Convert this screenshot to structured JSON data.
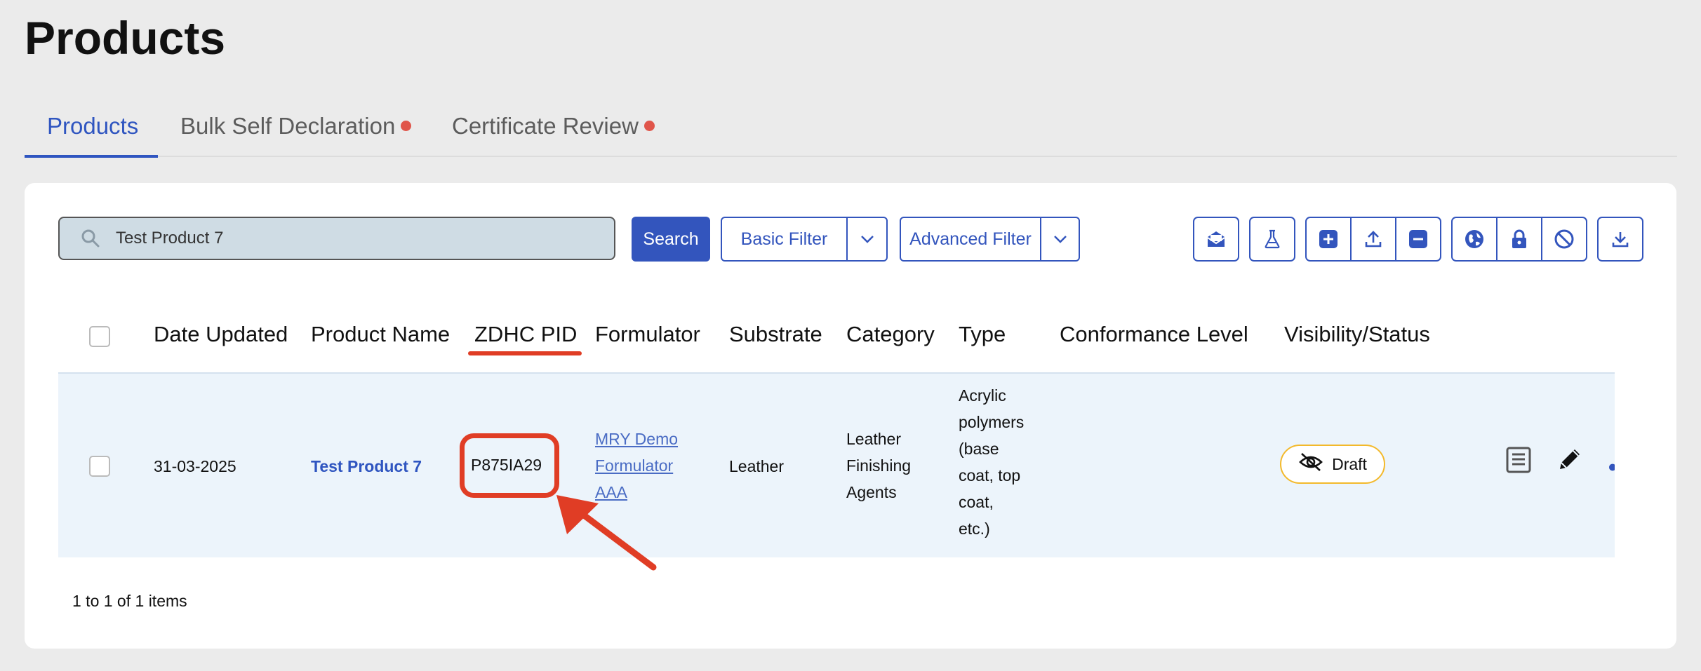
{
  "page": {
    "title": "Products"
  },
  "tabs": [
    {
      "label": "Products"
    },
    {
      "label": "Bulk Self Declaration"
    },
    {
      "label": "Certificate Review"
    }
  ],
  "toolbar": {
    "search_value": "Test Product 7",
    "search_button": "Search",
    "basic_filter": "Basic Filter",
    "advanced_filter": "Advanced Filter"
  },
  "table": {
    "headers": {
      "date_updated": "Date Updated",
      "product_name": "Product Name",
      "zdhc_pid": "ZDHC PID",
      "formulator": "Formulator",
      "substrate": "Substrate",
      "category": "Category",
      "type": "Type",
      "conformance_level": "Conformance Level",
      "visibility_status": "Visibility/Status"
    },
    "rows": [
      {
        "date_updated": "31-03-2025",
        "product_name": "Test Product 7",
        "zdhc_pid": "P875IA29",
        "formulator_lines": [
          "MRY Demo",
          "Formulator",
          "AAA"
        ],
        "substrate": "Leather",
        "category_lines": [
          "Leather",
          "Finishing",
          "Agents"
        ],
        "type_lines": [
          "Acrylic",
          "polymers",
          "(base",
          "coat, top",
          "coat,",
          "etc.)"
        ],
        "conformance_level": "",
        "status": "Draft"
      }
    ]
  },
  "pagination": {
    "text": "1 to 1 of 1 items"
  },
  "colors": {
    "primary": "#3355bd",
    "alert_dot": "#e0554a",
    "highlight": "#e03d25",
    "draft_border": "#f3b92b",
    "row_bg": "#ecf4fb"
  },
  "icons": [
    "search-icon",
    "envelope-open-icon",
    "flask-icon",
    "plus-square-icon",
    "upload-icon",
    "minus-square-icon",
    "globe-icon",
    "lock-icon",
    "ban-icon",
    "download-icon",
    "eye-slash-icon",
    "document-icon",
    "pencil-icon",
    "chevron-down-icon"
  ]
}
